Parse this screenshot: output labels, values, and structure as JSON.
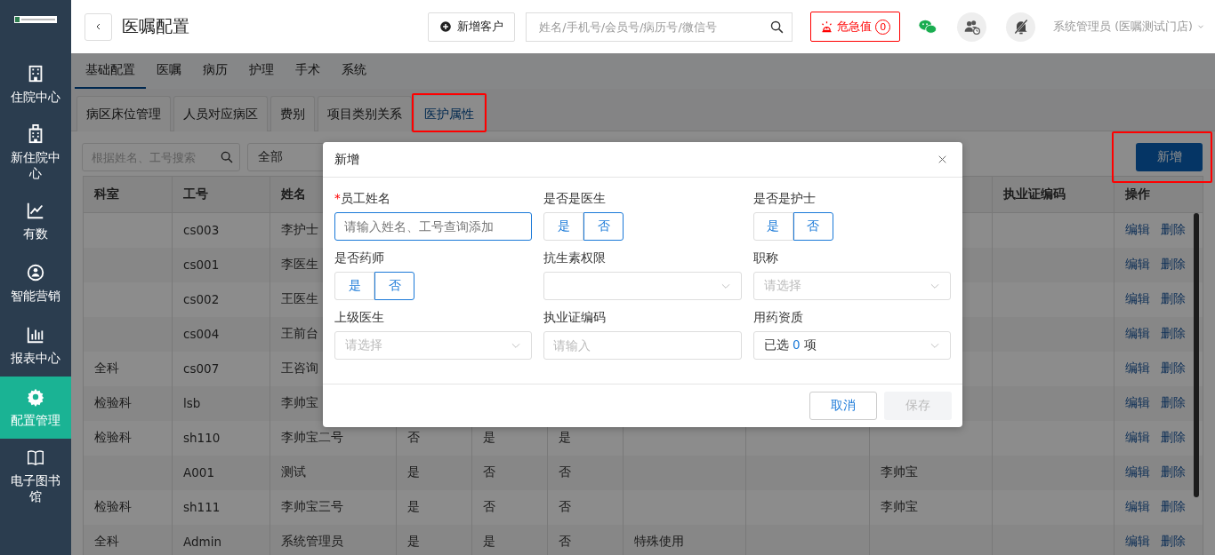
{
  "sidebar": {
    "items": [
      {
        "label": "住院中心",
        "selected": false
      },
      {
        "label": "新住院中心",
        "selected": false
      },
      {
        "label": "有数",
        "selected": false
      },
      {
        "label": "智能营销",
        "selected": false
      },
      {
        "label": "报表中心",
        "selected": false
      },
      {
        "label": "配置管理",
        "selected": true
      },
      {
        "label": "电子图书馆",
        "selected": false
      }
    ]
  },
  "header": {
    "title": "医嘱配置",
    "new_customer": "新增客户",
    "search": {
      "placeholder": "姓名/手机号/会员号/病历号/微信号"
    },
    "alert": {
      "label": "危急值",
      "count": "0"
    },
    "user": "系统管理员 (医嘱测试门店)"
  },
  "top_tabs": [
    {
      "label": "基础配置",
      "selected": true
    },
    {
      "label": "医嘱",
      "selected": false
    },
    {
      "label": "病历",
      "selected": false
    },
    {
      "label": "护理",
      "selected": false
    },
    {
      "label": "手术",
      "selected": false
    },
    {
      "label": "系统",
      "selected": false
    }
  ],
  "sub_tabs": [
    {
      "label": "病区床位管理",
      "selected": false,
      "highlighted": false
    },
    {
      "label": "人员对应病区",
      "selected": false,
      "highlighted": false
    },
    {
      "label": "费别",
      "selected": false,
      "highlighted": false
    },
    {
      "label": "项目类别关系",
      "selected": false,
      "highlighted": false
    },
    {
      "label": "医护属性",
      "selected": true,
      "highlighted": true
    }
  ],
  "filters": {
    "search": {
      "placeholder": "根据姓名、工号搜索"
    },
    "select": {
      "value": "全部"
    }
  },
  "add_button": {
    "label": "新增",
    "highlighted": true
  },
  "table": {
    "columns": [
      {
        "label": "科室"
      },
      {
        "label": "工号"
      },
      {
        "label": "姓名"
      },
      {},
      {},
      {},
      {},
      {},
      {},
      {
        "label": "执业证编码"
      },
      {
        "label": "操作"
      }
    ],
    "rows": [
      {
        "staff_id": "cs003",
        "name": "李护士",
        "actions": [
          "编辑",
          "删除"
        ]
      },
      {
        "staff_id": "cs001",
        "name": "李医生",
        "actions": [
          "编辑",
          "删除"
        ]
      },
      {
        "staff_id": "cs002",
        "name": "王医生",
        "actions": [
          "编辑",
          "删除"
        ]
      },
      {
        "staff_id": "cs004",
        "name": "王前台",
        "actions": [
          "编辑",
          "删除"
        ]
      },
      {
        "department": "全科",
        "staff_id": "cs007",
        "name": "王咨询",
        "actions": [
          "编辑",
          "删除"
        ]
      },
      {
        "department": "检验科",
        "staff_id": "lsb",
        "name": "李帅宝",
        "actions": [
          "编辑",
          "删除"
        ]
      },
      {
        "department": "检验科",
        "staff_id": "sh110",
        "name": "李帅宝二号",
        "column_4": "否",
        "column_5": "是",
        "column_6": "是",
        "actions": [
          "编辑",
          "删除"
        ]
      },
      {
        "staff_id": "A001",
        "name": "测试",
        "column_4": "是",
        "column_5": "否",
        "column_6": "否",
        "column_9": "李帅宝",
        "actions": [
          "编辑",
          "删除"
        ]
      },
      {
        "department": "检验科",
        "staff_id": "sh111",
        "name": "李帅宝三号",
        "column_4": "是",
        "column_5": "否",
        "column_6": "否",
        "column_9": "李帅宝",
        "actions": [
          "编辑",
          "删除"
        ]
      },
      {
        "department": "全科",
        "staff_id": "Admin",
        "name": "系统管理员",
        "column_4": "是",
        "column_5": "是",
        "column_6": "否",
        "column_7": "特殊使用",
        "actions": [
          "编辑",
          "删除"
        ]
      }
    ]
  },
  "dialog": {
    "title": "新增",
    "rows": [
      [
        {
          "kind": "input",
          "required_mark": "*",
          "label": "员工姓名",
          "placeholder": "请输入姓名、工号查询添加",
          "focused": true
        },
        {
          "kind": "toggle",
          "label": "是否是医生",
          "options": [
            {
              "label": "是",
              "selected": false
            },
            {
              "label": "否",
              "selected": true
            }
          ]
        },
        {
          "kind": "toggle",
          "label": "是否是护士",
          "options": [
            {
              "label": "是",
              "selected": false
            },
            {
              "label": "否",
              "selected": true
            }
          ]
        }
      ],
      [
        {
          "kind": "toggle",
          "label": "是否药师",
          "options": [
            {
              "label": "是",
              "selected": false
            },
            {
              "label": "否",
              "selected": true
            }
          ]
        },
        {
          "kind": "select",
          "label": "抗生素权限"
        },
        {
          "kind": "select",
          "label": "职称",
          "placeholder": "请选择"
        }
      ],
      [
        {
          "kind": "select",
          "label": "上级医生",
          "placeholder": "请选择"
        },
        {
          "kind": "input",
          "label": "执业证编码",
          "placeholder": "请输入",
          "focused": false
        },
        {
          "kind": "multiselect",
          "label": "用药资质",
          "prefix": "已选",
          "count": "0",
          "suffix": "项"
        }
      ]
    ],
    "cancel": "取消",
    "save": {
      "label": "保存",
      "disabled": true
    }
  }
}
